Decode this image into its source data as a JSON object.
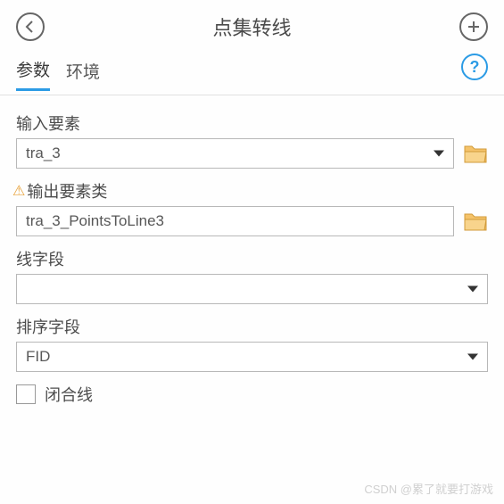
{
  "header": {
    "title": "点集转线"
  },
  "tabs": {
    "params": "参数",
    "env": "环境"
  },
  "fields": {
    "input_features": {
      "label": "输入要素",
      "value": "tra_3"
    },
    "output_fc": {
      "label": "输出要素类",
      "value": "tra_3_PointsToLine3"
    },
    "line_field": {
      "label": "线字段",
      "value": ""
    },
    "sort_field": {
      "label": "排序字段",
      "value": "FID"
    },
    "close_line": {
      "label": "闭合线"
    }
  },
  "watermark": "CSDN @累了就要打游戏"
}
